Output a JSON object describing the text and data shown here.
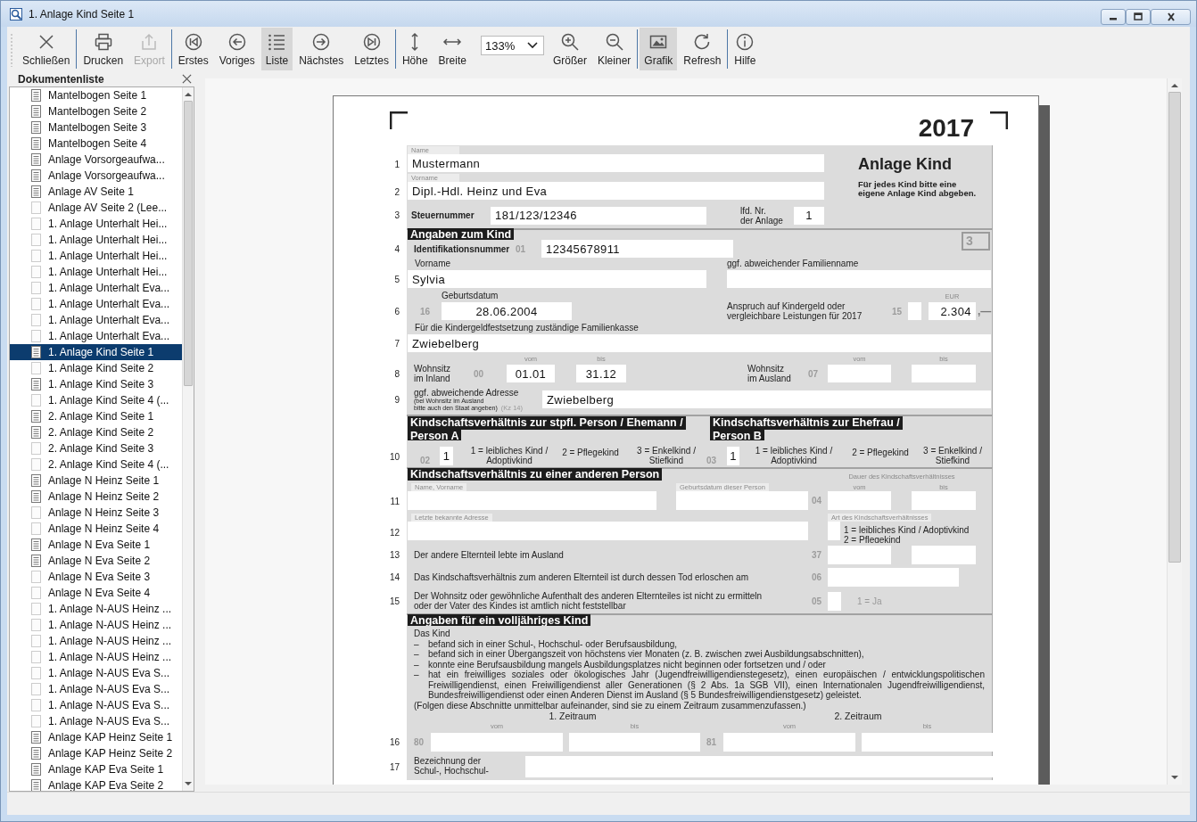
{
  "window": {
    "title": "1. Anlage Kind Seite 1"
  },
  "toolbar": {
    "groups": [
      [
        {
          "kind": "button",
          "label": "Schließen",
          "selected": false,
          "disabled": false
        }
      ],
      [
        {
          "kind": "button",
          "label": "Drucken",
          "selected": false,
          "disabled": false
        },
        {
          "kind": "button",
          "label": "Export",
          "selected": false,
          "disabled": true
        }
      ],
      [
        {
          "kind": "button",
          "label": "Erstes",
          "selected": false,
          "disabled": false
        },
        {
          "kind": "button",
          "label": "Voriges",
          "selected": false,
          "disabled": false
        },
        {
          "kind": "button",
          "label": "Liste",
          "selected": true,
          "disabled": false
        },
        {
          "kind": "button",
          "label": "Nächstes",
          "selected": false,
          "disabled": false
        },
        {
          "kind": "button",
          "label": "Letztes",
          "selected": false,
          "disabled": false
        }
      ],
      [
        {
          "kind": "button",
          "label": "Höhe",
          "selected": false,
          "disabled": false
        },
        {
          "kind": "button",
          "label": "Breite",
          "selected": false,
          "disabled": false
        },
        {
          "kind": "dropdown",
          "value": "133%"
        },
        {
          "kind": "button",
          "label": "Größer",
          "selected": false,
          "disabled": false
        },
        {
          "kind": "button",
          "label": "Kleiner",
          "selected": false,
          "disabled": false
        }
      ],
      [
        {
          "kind": "button",
          "label": "Grafik",
          "selected": true,
          "disabled": false
        },
        {
          "kind": "button",
          "label": "Refresh",
          "selected": false,
          "disabled": false
        }
      ],
      [
        {
          "kind": "button",
          "label": "Hilfe",
          "selected": false,
          "disabled": false
        }
      ]
    ]
  },
  "sidebar": {
    "title": "Dokumentenliste",
    "items": [
      {
        "label": "Mantelbogen Seite 1",
        "filled": true,
        "selected": false
      },
      {
        "label": "Mantelbogen Seite 2",
        "filled": true,
        "selected": false
      },
      {
        "label": "Mantelbogen Seite 3",
        "filled": true,
        "selected": false
      },
      {
        "label": "Mantelbogen Seite 4",
        "filled": true,
        "selected": false
      },
      {
        "label": "Anlage Vorsorgeaufwa...",
        "filled": true,
        "selected": false
      },
      {
        "label": "Anlage Vorsorgeaufwa...",
        "filled": true,
        "selected": false
      },
      {
        "label": "Anlage AV Seite 1",
        "filled": true,
        "selected": false
      },
      {
        "label": "Anlage AV Seite 2 (Lee...",
        "filled": false,
        "selected": false
      },
      {
        "label": "1. Anlage Unterhalt Hei...",
        "filled": false,
        "selected": false
      },
      {
        "label": "1. Anlage Unterhalt Hei...",
        "filled": false,
        "selected": false
      },
      {
        "label": "1. Anlage Unterhalt Hei...",
        "filled": false,
        "selected": false
      },
      {
        "label": "1. Anlage Unterhalt Hei...",
        "filled": false,
        "selected": false
      },
      {
        "label": "1. Anlage Unterhalt Eva...",
        "filled": false,
        "selected": false
      },
      {
        "label": "1. Anlage Unterhalt Eva...",
        "filled": false,
        "selected": false
      },
      {
        "label": "1. Anlage Unterhalt Eva...",
        "filled": false,
        "selected": false
      },
      {
        "label": "1. Anlage Unterhalt Eva...",
        "filled": false,
        "selected": false
      },
      {
        "label": "1. Anlage Kind Seite 1",
        "filled": true,
        "selected": true
      },
      {
        "label": "1. Anlage Kind Seite 2",
        "filled": false,
        "selected": false
      },
      {
        "label": "1. Anlage Kind Seite 3",
        "filled": true,
        "selected": false
      },
      {
        "label": "1. Anlage Kind Seite 4 (...",
        "filled": false,
        "selected": false
      },
      {
        "label": "2. Anlage Kind Seite 1",
        "filled": true,
        "selected": false
      },
      {
        "label": "2. Anlage Kind Seite 2",
        "filled": true,
        "selected": false
      },
      {
        "label": "2. Anlage Kind Seite 3",
        "filled": false,
        "selected": false
      },
      {
        "label": "2. Anlage Kind Seite 4 (...",
        "filled": false,
        "selected": false
      },
      {
        "label": "Anlage N Heinz Seite 1",
        "filled": true,
        "selected": false
      },
      {
        "label": "Anlage N Heinz Seite 2",
        "filled": true,
        "selected": false
      },
      {
        "label": "Anlage N Heinz Seite 3",
        "filled": false,
        "selected": false
      },
      {
        "label": "Anlage N Heinz Seite 4",
        "filled": false,
        "selected": false
      },
      {
        "label": "Anlage N Eva Seite 1",
        "filled": true,
        "selected": false
      },
      {
        "label": "Anlage N Eva Seite 2",
        "filled": true,
        "selected": false
      },
      {
        "label": "Anlage N Eva Seite 3",
        "filled": false,
        "selected": false
      },
      {
        "label": "Anlage N Eva Seite 4",
        "filled": false,
        "selected": false
      },
      {
        "label": "1. Anlage N-AUS Heinz ...",
        "filled": false,
        "selected": false
      },
      {
        "label": "1. Anlage N-AUS Heinz ...",
        "filled": false,
        "selected": false
      },
      {
        "label": "1. Anlage N-AUS Heinz ...",
        "filled": false,
        "selected": false
      },
      {
        "label": "1. Anlage N-AUS Heinz ...",
        "filled": false,
        "selected": false
      },
      {
        "label": "1. Anlage N-AUS Eva S...",
        "filled": false,
        "selected": false
      },
      {
        "label": "1. Anlage N-AUS Eva S...",
        "filled": false,
        "selected": false
      },
      {
        "label": "1. Anlage N-AUS Eva S...",
        "filled": false,
        "selected": false
      },
      {
        "label": "1. Anlage N-AUS Eva S...",
        "filled": false,
        "selected": false
      },
      {
        "label": "Anlage KAP Heinz Seite 1",
        "filled": true,
        "selected": false
      },
      {
        "label": "Anlage KAP Heinz Seite 2",
        "filled": true,
        "selected": false
      },
      {
        "label": "Anlage KAP Eva Seite 1",
        "filled": true,
        "selected": false
      },
      {
        "label": "Anlage KAP Eva Seite 2",
        "filled": true,
        "selected": false
      }
    ]
  },
  "form": {
    "year": "2017",
    "title": "Anlage Kind",
    "note": "Für jedes Kind bitte eine\neigene Anlage Kind abgeben.",
    "person": {
      "line_1": "1",
      "name_label": "Name",
      "name": "Mustermann",
      "line_2": "2",
      "vorname_label": "Vorname",
      "vorname": "Dipl.-Hdl. Heinz und Eva",
      "line_3": "3",
      "stnr_label": "Steuernummer",
      "stnr": "181/123/12346",
      "lfd_label": "lfd. Nr.\nder Anlage",
      "lfd": "1"
    },
    "child": {
      "heading": "Angaben zum Kind",
      "page_mark": "3",
      "line_4": "4",
      "id_label": "Identifikationsnummer",
      "id_code": "01",
      "id": "12345678911",
      "vorname_label": "Vorname",
      "familienname_label": "ggf. abweichender Familienname",
      "line_5": "5",
      "vorname": "Sylvia",
      "geb_label": "Geburtsdatum",
      "eur_label": "EUR",
      "line_6": "6",
      "geb_code": "16",
      "geburtsdatum": "28.06.2004",
      "anspruch_label": "Anspruch auf Kindergeld oder\nvergleichbare Leistungen für 2017",
      "anspruch_code": "15",
      "anspruch": "2.304",
      "anspruch_suffix": ",—",
      "kasse_label": "Für die Kindergeldfestsetzung zuständige Familienkasse",
      "line_7": "7",
      "kasse": "Zwiebelberg",
      "vom_1": "vom",
      "bis_1": "bis",
      "vom_2": "vom",
      "bis_2": "bis",
      "line_8": "8",
      "inland_label": "Wohnsitz\nim Inland",
      "inland_code": "00",
      "inland_vom": "01.01",
      "inland_bis": "31.12",
      "ausland_label": "Wohnsitz\nim Ausland",
      "ausland_code": "07",
      "line_9": "9",
      "adresse_label": "ggf. abweichende Adresse",
      "adresse_hint": "(bei Wohnsitz im Ausland\nbitte auch den Staat angeben)",
      "adresse_kz": "(Kz 14)",
      "adresse": "Zwiebelberg"
    },
    "relation": {
      "heading_a": [
        "Kindschaftsverhältnis zur stpfl. Person / Ehemann /",
        "Person A"
      ],
      "heading_b": [
        "Kindschaftsverhältnis zur Ehefrau /",
        "Person B"
      ],
      "line_10": "10",
      "code_a": "02",
      "value_a": "1",
      "options_a": [
        "1 = leibliches Kind /\nAdoptivkind",
        "2 = Pflegekind",
        "3 = Enkelkind /\nStiefkind"
      ],
      "code_b": "03",
      "value_b": "1",
      "options_b": [
        "1 = leibliches Kind /\nAdoptivkind",
        "2 = Pflegekind",
        "3 = Enkelkind /\nStiefkind"
      ]
    },
    "other": {
      "heading": "Kindschaftsverhältnis zu einer anderen Person",
      "dauer_label": "Dauer des Kindschaftsverhältnisses",
      "name_label": "Name, Vorname",
      "geb_label": "Geburtsdatum dieser Person",
      "vom": "vom",
      "bis": "bis",
      "line_11": "11",
      "code_04": "04",
      "adresse_label": "Letzte bekannte Adresse",
      "art_label": "Art des Kindschaftsverhältnisses",
      "line_12": "12",
      "art_options": "1 = leibliches Kind / Adoptivkind\n2 = Pflegekind",
      "line_13": "13",
      "ausland_text": "Der andere Elternteil lebte im Ausland",
      "code_37": "37",
      "line_14": "14",
      "tod_text": "Das Kindschaftsverhältnis zum anderen Elternteil ist durch dessen Tod erloschen am",
      "code_06": "06",
      "line_15": "15",
      "wohnsitz_text": "Der Wohnsitz oder gewöhnliche Aufenthalt des anderen Elternteiles ist nicht zu ermitteln\noder der Vater des Kindes ist amtlich nicht feststellbar",
      "code_05": "05",
      "ja_label": "1 = Ja"
    },
    "adult": {
      "heading": "Angaben für ein volljähriges Kind",
      "intro": "Das Kind",
      "bullets": [
        {
          "dash": "–",
          "text": "befand sich in einer Schul-, Hochschul- oder Berufsausbildung,"
        },
        {
          "dash": "–",
          "text": "befand sich in einer Übergangszeit von höchstens vier Monaten (z. B. zwischen zwei Ausbildungsabschnitten),"
        },
        {
          "dash": "–",
          "text": "konnte eine Berufsausbildung mangels Ausbildungsplatzes nicht beginnen oder fortsetzen und / oder"
        },
        {
          "dash": "–",
          "text": "hat ein freiwilliges soziales oder ökologisches Jahr (Jugendfreiwilligendienstegesetz), einen europäischen / entwicklungspolitischen Freiwilligendienst, einen Freiwilligendienst aller Generationen (§ 2 Abs. 1a SGB VII), einen Internationalen Jugendfreiwilligendienst, Bundesfreiwilligendienst oder einen Anderen Dienst im Ausland (§ 5 Bundesfreiwilligendienstgesetz) geleistet."
        }
      ],
      "note": "(Folgen diese Abschnitte unmittelbar aufeinander, sind sie zu einem Zeitraum zusammenzufassen.)",
      "period_1": "1. Zeitraum",
      "period_2": "2. Zeitraum",
      "vom_1": "vom",
      "bis_1": "bis",
      "vom_2": "vom",
      "bis_2": "bis",
      "line_16": "16",
      "code_80": "80",
      "code_81": "81",
      "line_17": "17",
      "bezeichnung_label": "Bezeichnung der\nSchul-, Hochschul-"
    }
  }
}
